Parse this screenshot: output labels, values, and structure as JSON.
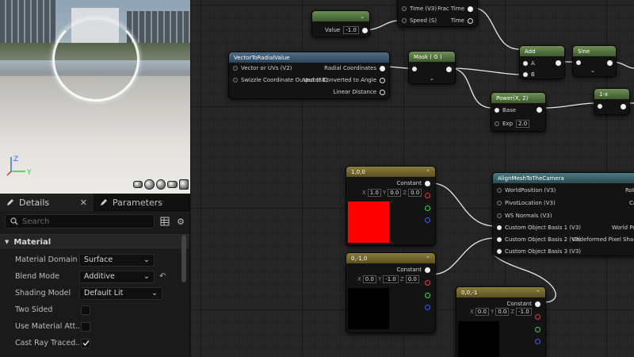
{
  "details": {
    "tab_details": "Details",
    "tab_parameters": "Parameters",
    "search_placeholder": "Search",
    "section_material": "Material",
    "props": [
      {
        "label": "Material Domain",
        "value": "Surface"
      },
      {
        "label": "Blend Mode",
        "value": "Additive"
      },
      {
        "label": "Shading Model",
        "value": "Default Lit"
      },
      {
        "label": "Two Sided",
        "checked": false
      },
      {
        "label": "Use Material Att...",
        "checked": false
      },
      {
        "label": "Cast Ray Traced...",
        "checked": true
      }
    ]
  },
  "viewport": {
    "axis_z": "Z",
    "axis_y": "Y"
  },
  "nodes": {
    "scalar": {
      "value_label": "Value",
      "value": "-1.0"
    },
    "time": {
      "pin_time": "Time (V3)",
      "pin_speed": "Speed (S)",
      "out_frac": "Frac Time",
      "out_time": "Time"
    },
    "v2r": {
      "title": "VectorToRadialValue",
      "in_uv": "Vector or UVs (V2)",
      "in_swizzle": "Swizzle Coordinate Output (SB)",
      "out_radial": "Radial Coordinates",
      "out_angle": "Vector Converted to Angle",
      "out_linear": "Linear Distance"
    },
    "mask": {
      "title": "Mask ( G )"
    },
    "add": {
      "title": "Add",
      "in_a": "A",
      "in_b": "B"
    },
    "sine": {
      "title": "Sine"
    },
    "power": {
      "title": "Power(X, 2)",
      "in_base": "Base",
      "in_exp": "Exp",
      "exp_value": "2.0"
    },
    "oneminus": {
      "title": "1-x"
    },
    "c100": {
      "title": "1,0,0",
      "label": "Constant",
      "x": "1.0",
      "y": "0.0",
      "z": "0.0",
      "x_label": "X",
      "y_label": "Y",
      "z_label": "Z"
    },
    "c0m10": {
      "title": "0,-1,0",
      "label": "Constant",
      "x": "0.0",
      "y": "-1.0",
      "z": "0.0",
      "x_label": "X",
      "y_label": "Y",
      "z_label": "Z"
    },
    "c00m1": {
      "title": "0,0,-1",
      "label": "Constant",
      "x": "0.0",
      "y": "0.0",
      "z": "-1.0",
      "x_label": "X",
      "y_label": "Y",
      "z_label": "Z"
    },
    "align": {
      "title": "AlignMeshToTheCamera",
      "in_wp": "WorldPosition (V3)",
      "in_pivot": "PivotLocation (V3)",
      "in_wsn": "WS Normals (V3)",
      "in_cob1": "Custom Object Basis 1 (V3)",
      "in_cob2": "Custom Object Basis 2 (V3)",
      "in_cob3": "Custom Object Basis 3 (V3)",
      "out_rot": "Rota",
      "out_ca": "Ca",
      "out_wp": "World Po",
      "out_undeformed": "Undeformed Pixel Shader W"
    }
  },
  "colors": {
    "constant_red": "#ff0000",
    "constant_black": "#000000"
  }
}
